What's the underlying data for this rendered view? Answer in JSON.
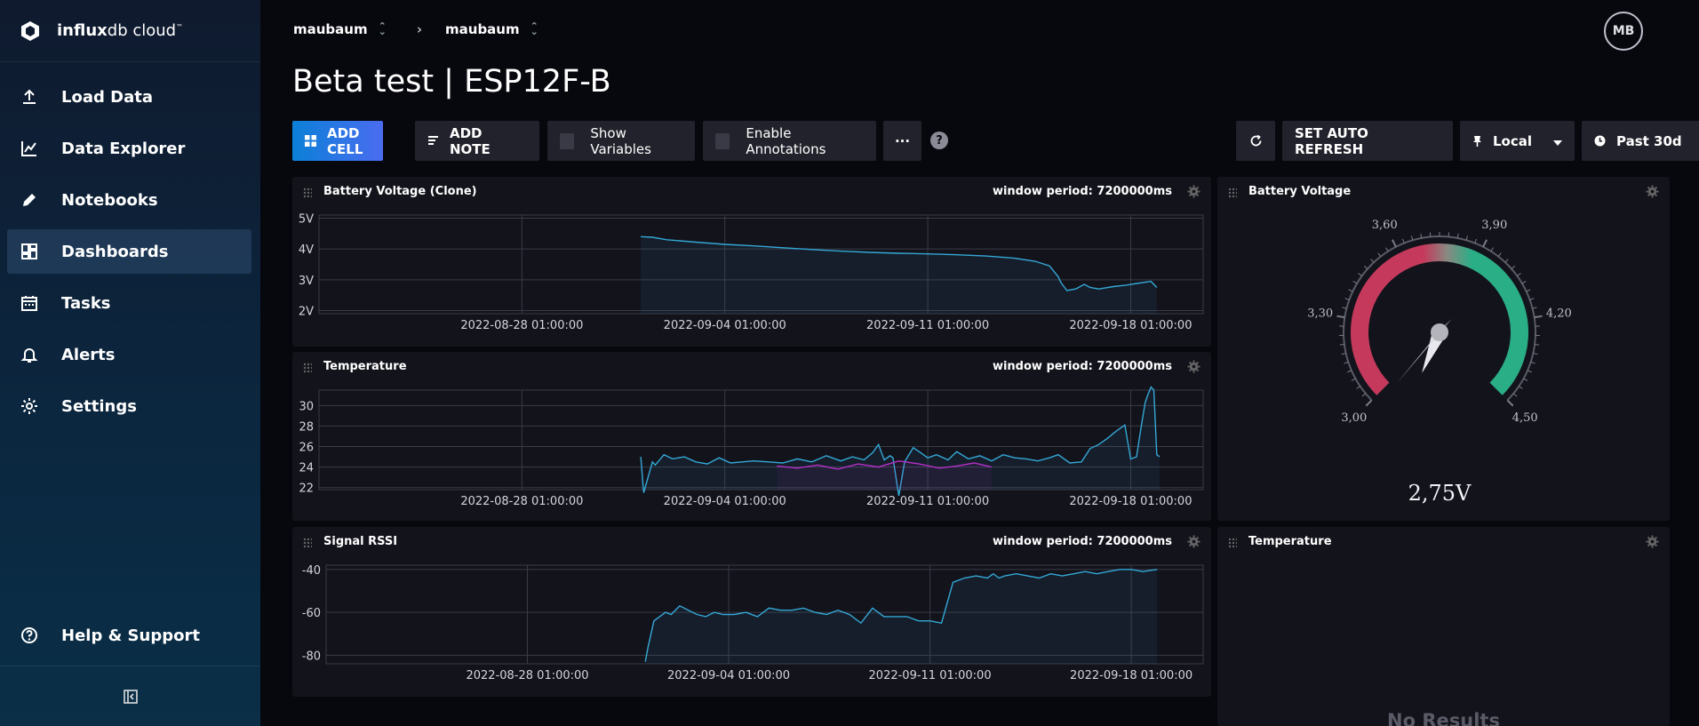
{
  "app": {
    "logo_bold": "influx",
    "logo_rest": "db cloud",
    "logo_tm": "™"
  },
  "sidebar": {
    "items": [
      {
        "label": "Load Data",
        "icon": "upload-icon"
      },
      {
        "label": "Data Explorer",
        "icon": "graph-icon"
      },
      {
        "label": "Notebooks",
        "icon": "pencil-icon"
      },
      {
        "label": "Dashboards",
        "icon": "dashboards-icon",
        "active": true
      },
      {
        "label": "Tasks",
        "icon": "calendar-icon"
      },
      {
        "label": "Alerts",
        "icon": "bell-icon"
      },
      {
        "label": "Settings",
        "icon": "gear-icon"
      }
    ],
    "help": "Help & Support"
  },
  "header": {
    "org": "maubaum",
    "bucket": "maubaum",
    "avatar": "MB",
    "title": "Beta test | ESP12F-B"
  },
  "toolbar": {
    "add_cell": "ADD CELL",
    "add_note": "ADD NOTE",
    "show_variables": "Show Variables",
    "enable_annotations": "Enable Annotations",
    "more": "···",
    "help": "?",
    "auto_refresh": "SET AUTO REFRESH",
    "timezone": "Local",
    "range": "Past 30d"
  },
  "colors": {
    "accent": "#0b80d8",
    "line": "#34a8d6",
    "line2": "#b42fc6",
    "gauge_red": "#c53a5c",
    "gauge_green": "#2aae86"
  },
  "cells": {
    "battery_clone": {
      "title": "Battery Voltage (Clone)",
      "meta": "window period: 7200000ms"
    },
    "temperature": {
      "title": "Temperature",
      "meta": "window period: 7200000ms"
    },
    "rssi": {
      "title": "Signal RSSI",
      "meta": "window period: 7200000ms"
    },
    "gauge": {
      "title": "Battery Voltage"
    },
    "temp2": {
      "title": "Temperature",
      "no_results": "No Results"
    }
  },
  "chart_data": [
    {
      "type": "line",
      "title": "Battery Voltage (Clone)",
      "x_ticks": [
        "2022-08-28 01:00:00",
        "2022-09-04 01:00:00",
        "2022-09-11 01:00:00",
        "2022-09-18 01:00:00"
      ],
      "x_tick_days": [
        7,
        14,
        21,
        28
      ],
      "x_range_days": [
        0,
        30.5
      ],
      "y_ticks": [
        "2V",
        "3V",
        "4V",
        "5V"
      ],
      "y_tick_values": [
        2,
        3,
        4,
        5
      ],
      "ylim": [
        1.9,
        5.1
      ],
      "x": [
        11.1,
        11.5,
        12,
        13,
        14,
        15,
        16,
        17,
        18,
        19,
        20,
        21,
        22,
        23,
        24,
        24.7,
        25.2,
        25.5,
        25.6,
        25.8,
        26.1,
        26.4,
        26.6,
        26.9,
        27.4,
        27.8,
        28.2,
        28.7,
        28.9
      ],
      "y": [
        4.4,
        4.38,
        4.3,
        4.22,
        4.15,
        4.1,
        4.04,
        3.98,
        3.93,
        3.89,
        3.86,
        3.84,
        3.81,
        3.77,
        3.7,
        3.6,
        3.45,
        3.1,
        2.9,
        2.65,
        2.7,
        2.85,
        2.75,
        2.7,
        2.78,
        2.82,
        2.88,
        2.95,
        2.75
      ],
      "grid": true
    },
    {
      "type": "line",
      "title": "Temperature",
      "x_ticks": [
        "2022-08-28 01:00:00",
        "2022-09-04 01:00:00",
        "2022-09-11 01:00:00",
        "2022-09-18 01:00:00"
      ],
      "x_tick_days": [
        7,
        14,
        21,
        28
      ],
      "x_range_days": [
        0,
        30.5
      ],
      "y_ticks": [
        "22",
        "24",
        "26",
        "28",
        "30"
      ],
      "y_tick_values": [
        22,
        24,
        26,
        28,
        30
      ],
      "ylim": [
        21.8,
        31.5
      ],
      "series": [
        {
          "x": [
            11.1,
            11.2,
            11.5,
            11.6,
            11.9,
            12.2,
            12.6,
            13,
            13.4,
            13.8,
            14.2,
            14.6,
            15,
            15.5,
            16,
            16.5,
            17,
            17.5,
            18,
            18.4,
            18.8,
            19.1,
            19.3,
            19.5,
            19.7,
            19.8,
            20,
            20.2,
            20.5,
            20.8,
            21,
            21.3,
            21.7,
            22,
            22.4,
            22.8,
            23.2,
            23.6,
            24,
            24.4,
            24.8,
            25.2,
            25.5,
            25.9,
            26.3,
            26.6,
            26.9,
            27.2,
            27.5,
            27.8,
            28,
            28.2,
            28.3,
            28.4,
            28.5,
            28.6,
            28.7,
            28.8,
            28.9,
            29
          ],
          "y": [
            25,
            21.5,
            24.5,
            24.2,
            25.2,
            24.8,
            25,
            24.5,
            24.3,
            24.9,
            24.4,
            24.5,
            24.6,
            24.5,
            24.4,
            24.8,
            24.5,
            25.1,
            24.6,
            25,
            24.7,
            25.4,
            26.2,
            24.7,
            25.1,
            24.9,
            21.2,
            24.5,
            25.9,
            25.3,
            24.9,
            25.2,
            24.7,
            25.5,
            24.8,
            25.1,
            24.6,
            25.2,
            24.9,
            24.8,
            24.6,
            24.9,
            25.2,
            24.4,
            24.5,
            25.8,
            26.2,
            26.8,
            27.5,
            28.1,
            24.8,
            25,
            26.8,
            28.6,
            30.3,
            31.1,
            31.8,
            31.5,
            25.2,
            25
          ],
          "color": "line"
        },
        {
          "x": [
            15.8,
            16.5,
            17.2,
            17.9,
            18.6,
            19.3,
            20,
            20.7,
            21.4,
            22,
            22.6,
            23.2
          ],
          "y": [
            24.1,
            23.9,
            24.2,
            23.8,
            24.3,
            24.0,
            24.6,
            24.3,
            23.9,
            24.1,
            24.4,
            24.0
          ],
          "color": "line2"
        }
      ],
      "grid": true
    },
    {
      "type": "line",
      "title": "Signal RSSI",
      "x_ticks": [
        "2022-08-28 01:00:00",
        "2022-09-04 01:00:00",
        "2022-09-11 01:00:00",
        "2022-09-18 01:00:00"
      ],
      "x_tick_days": [
        7,
        14,
        21,
        28
      ],
      "x_range_days": [
        0,
        30.5
      ],
      "y_ticks": [
        "-80",
        "-60",
        "-40"
      ],
      "y_tick_values": [
        -80,
        -60,
        -40
      ],
      "ylim": [
        -84,
        -38
      ],
      "x": [
        11.1,
        11.2,
        11.4,
        11.6,
        11.8,
        12,
        12.3,
        12.6,
        12.9,
        13.2,
        13.5,
        13.8,
        14.2,
        14.6,
        15,
        15.4,
        15.8,
        16.2,
        16.6,
        17,
        17.4,
        17.8,
        18.2,
        18.6,
        19,
        19.4,
        19.8,
        20.2,
        20.6,
        21,
        21.4,
        21.8,
        22.2,
        22.6,
        23,
        23.2,
        23.4,
        23.6,
        24,
        24.4,
        24.8,
        25.2,
        25.6,
        26,
        26.4,
        26.8,
        27.2,
        27.6,
        28,
        28.4,
        28.9
      ],
      "y": [
        -83,
        -76,
        -64,
        -62,
        -60,
        -61,
        -57,
        -59,
        -61,
        -62,
        -60,
        -61,
        -61,
        -60,
        -62,
        -58,
        -59,
        -59,
        -58,
        -60,
        -61,
        -59,
        -61,
        -65,
        -58,
        -62,
        -62,
        -62,
        -64,
        -64,
        -65,
        -46,
        -44,
        -43,
        -44,
        -42,
        -44,
        -43,
        -42,
        -43,
        -44,
        -42,
        -43,
        -42,
        -41,
        -42,
        -41,
        -40,
        -40,
        -41,
        -40
      ],
      "grid": true
    },
    {
      "type": "gauge",
      "title": "Battery Voltage",
      "min": 3.0,
      "max": 4.5,
      "value": 2.75,
      "value_label": "2,75V",
      "tick_labels": [
        "3,00",
        "3,30",
        "3,60",
        "3,90",
        "4,20",
        "4,50"
      ],
      "tick_values": [
        3.0,
        3.3,
        3.6,
        3.9,
        4.2,
        4.5
      ]
    }
  ]
}
